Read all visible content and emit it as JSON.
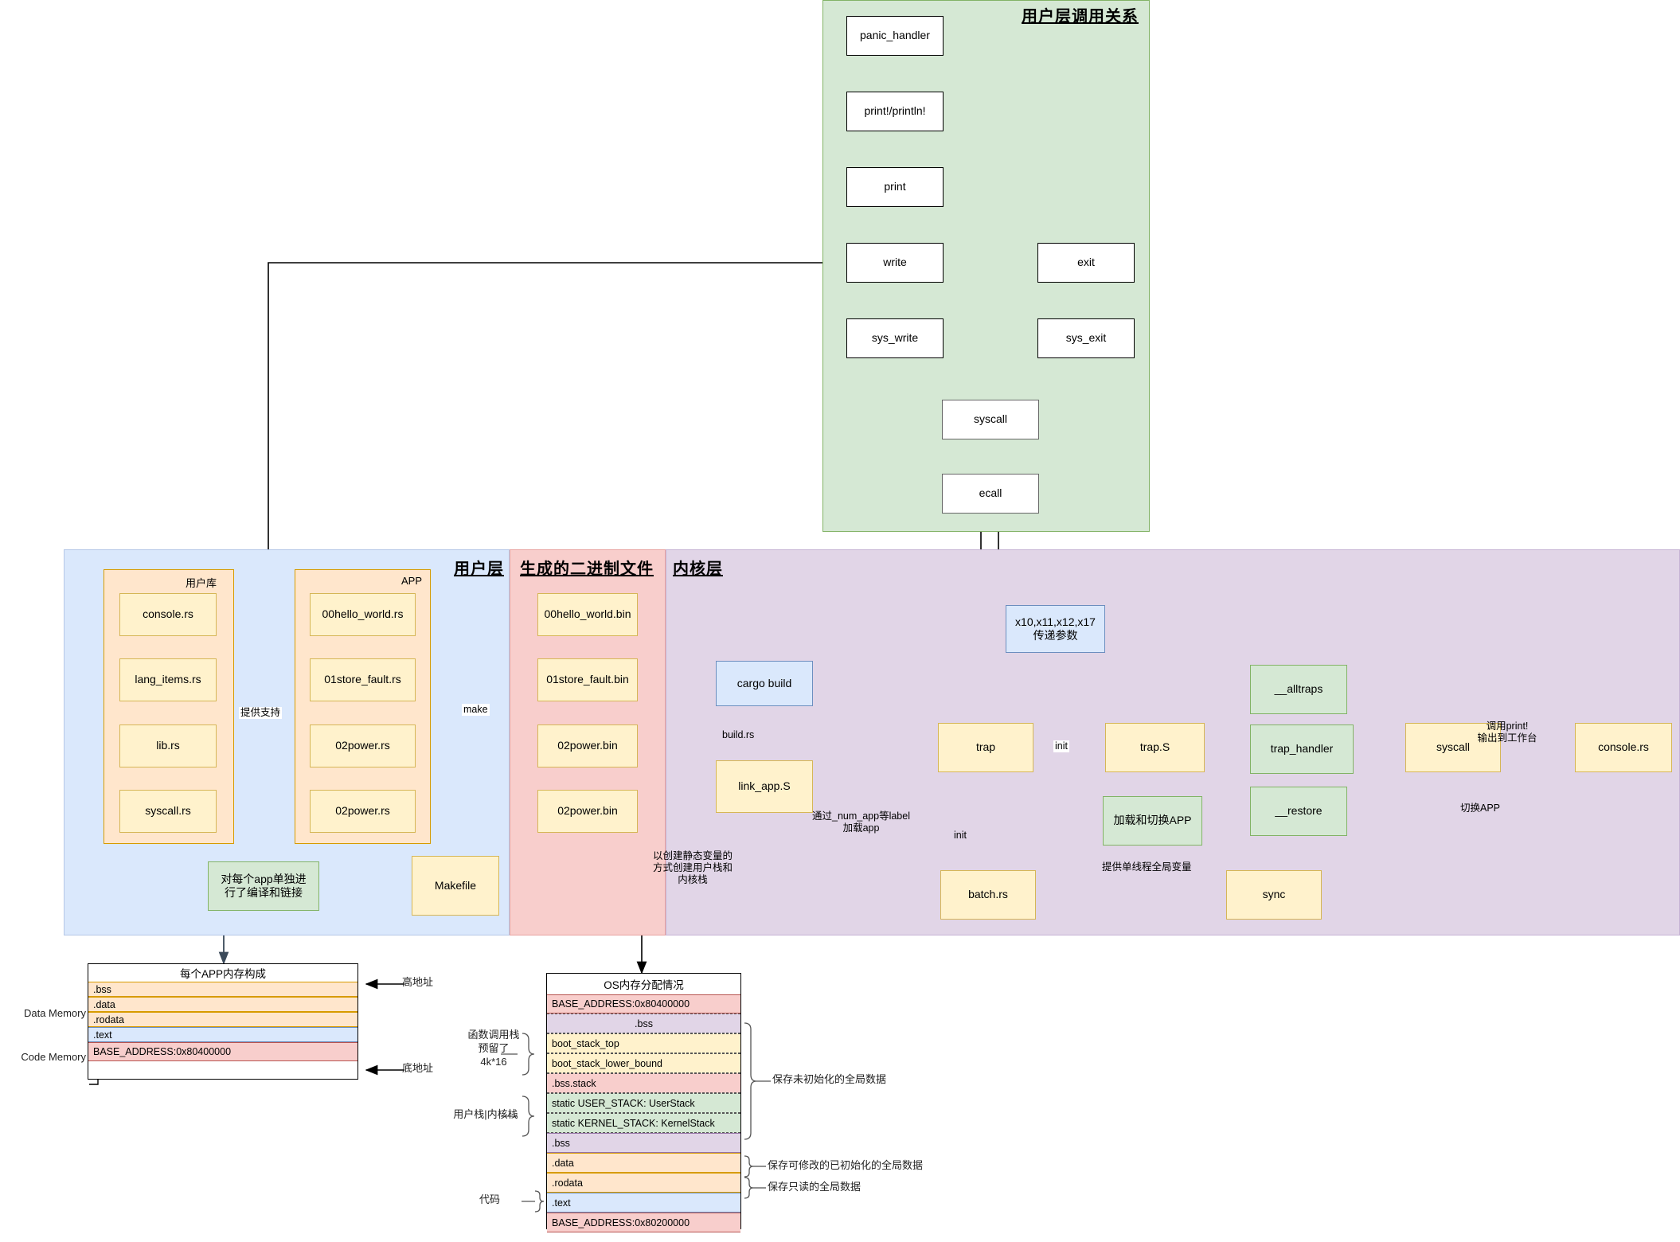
{
  "panels": {
    "user_call": {
      "title": "用户层调用关系"
    },
    "user_layer": {
      "title": "用户层"
    },
    "binaries": {
      "title": "生成的二进制文件"
    },
    "kernel": {
      "title": "内核层"
    }
  },
  "user_call_flow": {
    "nodes": [
      {
        "id": "panic_handler",
        "label": "panic_handler"
      },
      {
        "id": "print_macro",
        "label": "print!/println!"
      },
      {
        "id": "print",
        "label": "print"
      },
      {
        "id": "write",
        "label": "write"
      },
      {
        "id": "exit",
        "label": "exit"
      },
      {
        "id": "sys_write",
        "label": "sys_write"
      },
      {
        "id": "sys_exit",
        "label": "sys_exit"
      },
      {
        "id": "syscall",
        "label": "syscall"
      },
      {
        "id": "ecall",
        "label": "ecall"
      }
    ]
  },
  "user_layer": {
    "lib_group": {
      "label": "用户库",
      "items": [
        "console.rs",
        "lang_items.rs",
        "lib.rs",
        "syscall.rs"
      ]
    },
    "app_group": {
      "label": "APP",
      "items": [
        "00hello_world.rs",
        "01store_fault.rs",
        "02power.rs",
        "02power.rs"
      ]
    },
    "makefile": {
      "label": "Makefile"
    },
    "compile_note": {
      "label": "对每个app单独进\n行了编译和链接"
    },
    "edge_labels": {
      "provide_support": "提供支持",
      "make": "make"
    }
  },
  "binaries": {
    "items": [
      "00hello_world.bin",
      "01store_fault.bin",
      "02power.bin",
      "02power.bin"
    ]
  },
  "kernel": {
    "cargo_build": {
      "label": "cargo build"
    },
    "link_app": {
      "label": "link_app.S"
    },
    "trap": {
      "label": "trap"
    },
    "trap_s": {
      "label": "trap.S"
    },
    "alltraps": {
      "label": "__alltraps"
    },
    "trap_handler": {
      "label": "trap_handler"
    },
    "restore": {
      "label": "__restore"
    },
    "syscall": {
      "label": "syscall"
    },
    "console_rs": {
      "label": "console.rs"
    },
    "load_switch_app": {
      "label": "加载和切换APP"
    },
    "batch_rs": {
      "label": "batch.rs"
    },
    "sync": {
      "label": "sync"
    },
    "regs_note": {
      "label": "x10,x11,x12,x17\n传递参数"
    },
    "edge_labels": {
      "build_rs": "build.rs",
      "num_app_label": "通过_num_app等label\n加载app",
      "static_var_note": "以创建静态变量的\n方式创建用户栈和\n内核栈",
      "init_trap": "init",
      "init_batch": "init",
      "single_thread_global": "提供单线程全局变量",
      "call_print": "调用print!\n输出到工作台",
      "switch_app": "切换APP"
    }
  },
  "app_memory": {
    "title": "每个APP内存构成",
    "rows": [
      ".bss",
      ".data",
      ".rodata",
      ".text",
      "BASE_ADDRESS:0x80400000"
    ],
    "left_labels": [
      "Data Memory",
      "Code Memory"
    ],
    "right_labels": [
      "高地址",
      "底地址"
    ]
  },
  "os_memory": {
    "title": "OS内存分配情况",
    "rows": [
      "BASE_ADDRESS:0x80400000",
      ".bss",
      "boot_stack_top",
      "boot_stack_lower_bound",
      ".bss.stack",
      "static USER_STACK: UserStack",
      "static KERNEL_STACK: KernelStack",
      ".bss",
      ".data",
      ".rodata",
      ".text",
      "BASE_ADDRESS:0x80200000"
    ],
    "left_labels": [
      "函数调用栈\n预留了\n4k*16",
      "用户栈|内核栈",
      "代码"
    ],
    "right_labels": [
      "保存未初始化的全局数据",
      "保存可修改的已初始化的全局数据",
      "保存只读的全局数据"
    ]
  },
  "colors": {
    "green_panel": "#d5e8d4",
    "blue_panel": "#dae8fc",
    "pink_panel": "#f8cecc",
    "purple_panel": "#e1d5e7",
    "yellow_node": "#fff2cc",
    "orange_node": "#ffe6cc",
    "stroke": "#000000"
  }
}
